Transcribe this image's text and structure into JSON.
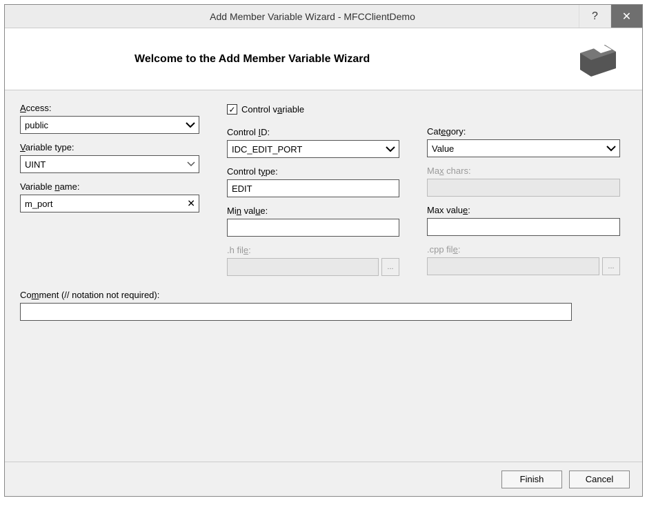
{
  "titlebar": {
    "title": "Add Member Variable Wizard - MFCClientDemo",
    "help": "?",
    "close": "✕"
  },
  "banner": {
    "title": "Welcome to the Add Member Variable Wizard"
  },
  "labels": {
    "access": "ccess:",
    "variable_type": "ariable type:",
    "variable_name": "Variable ",
    "variable_name2": "ame:",
    "control_variable": "Control v",
    "control_variable2": "riable",
    "control_id": "Control ",
    "control_id2": "D:",
    "control_type": "Control t",
    "control_type2": "pe:",
    "min_value": "Mi",
    "min_value2": " val",
    "min_value3": "e:",
    "category": "Cat",
    "category2": "gory:",
    "max_chars": "Ma",
    "max_chars2": " chars:",
    "max_value": "Max valu",
    "max_value2": ":",
    "h_file": ".h fil",
    "h_file2": ":",
    "cpp_file": ".cpp fil",
    "cpp_file2": ":",
    "comment": "Co",
    "comment2": "ment (// notation not required):"
  },
  "values": {
    "access": "public",
    "variable_type": "UINT",
    "variable_name": "m_port",
    "control_id": "IDC_EDIT_PORT",
    "control_type": "EDIT",
    "category": "Value",
    "min_value": "",
    "max_value": "",
    "comment": ""
  },
  "buttons": {
    "finish": "Finish",
    "cancel": "Cancel",
    "browse": "..."
  },
  "checkbox": {
    "control_variable_checked": "✓"
  }
}
